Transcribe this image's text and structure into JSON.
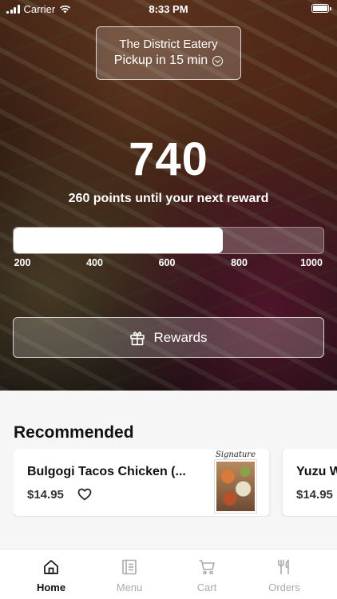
{
  "status_bar": {
    "carrier": "Carrier",
    "time": "8:33 PM"
  },
  "location": {
    "name": "The District Eatery",
    "pickup": "Pickup in 15 min"
  },
  "loyalty": {
    "points": "740",
    "subtitle": "260 points until your next reward",
    "progress_min": 200,
    "progress_max": 1000,
    "progress_value": 740,
    "ticks": [
      "200",
      "400",
      "600",
      "800",
      "1000"
    ]
  },
  "rewards_button": {
    "label": "Rewards"
  },
  "recommended": {
    "title": "Recommended",
    "items": [
      {
        "name": "Bulgogi Tacos Chicken (...",
        "price": "$14.95",
        "thumb_caption": "Signature"
      },
      {
        "name": "Yuzu W",
        "price": "$14.95"
      }
    ]
  },
  "tabbar": {
    "tabs": [
      {
        "label": "Home",
        "icon": "home-icon",
        "active": true
      },
      {
        "label": "Menu",
        "icon": "menu-icon",
        "active": false
      },
      {
        "label": "Cart",
        "icon": "cart-icon",
        "active": false
      },
      {
        "label": "Orders",
        "icon": "orders-icon",
        "active": false
      }
    ]
  },
  "colors": {
    "text_dark": "#111111",
    "tab_inactive": "#aaaaaa",
    "hero_overlay": "#000000"
  }
}
